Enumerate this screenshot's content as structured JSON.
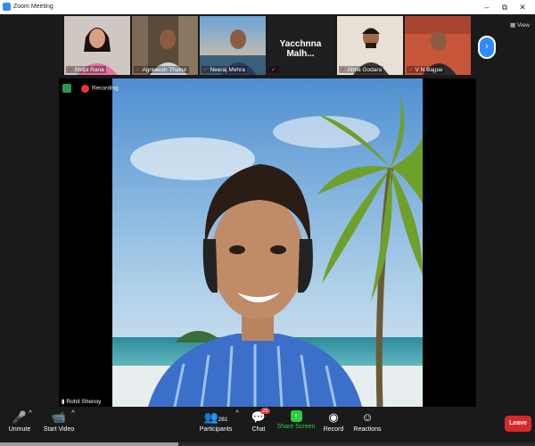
{
  "window": {
    "title": "Zoom Meeting"
  },
  "participants": [
    {
      "name": "Shilpi Rana"
    },
    {
      "name": "Agniwesh Thakur"
    },
    {
      "name": "Neeraj Mehra"
    },
    {
      "name": "Yacchnna  Malh..."
    },
    {
      "name": "Atma Godara"
    },
    {
      "name": "V N Bajpai"
    }
  ],
  "view_label": "View",
  "recording_label": "Recording",
  "active_speaker": "Rohit Shenoy",
  "toolbar": {
    "unmute": "Unmute",
    "start_video": "Start Video",
    "participants": "Participants",
    "participants_count": "281",
    "chat": "Chat",
    "chat_badge": "25",
    "share_screen": "Share Screen",
    "record": "Record",
    "reactions": "Reactions",
    "leave": "Leave"
  },
  "colors": {
    "accent": "#2d8cff",
    "share_green": "#2ecc40",
    "leave_red": "#d62a2a"
  }
}
